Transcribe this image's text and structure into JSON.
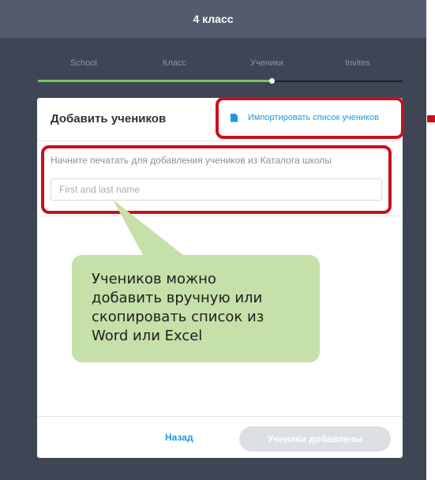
{
  "header": {
    "title": "4 класс"
  },
  "steps": [
    {
      "label": "School"
    },
    {
      "label": "Класс"
    },
    {
      "label": "Ученики"
    },
    {
      "label": "Invites"
    }
  ],
  "progress": {
    "completed_fraction": 0.64
  },
  "modal": {
    "title": "Добавить учеников",
    "import_label": "Импортировать список учеников",
    "import_icon": "document-icon",
    "hint": "Начните печатать для добавления учеников из Каталога школы",
    "name_input": {
      "value": "",
      "placeholder": "First and last name"
    },
    "back_label": "Назад",
    "done_label": "Ученики добавлены"
  },
  "callout": {
    "text": "Учеников можно\nдобавить вручную или\nскопировать список из\nWord или Excel"
  },
  "colors": {
    "app_background": "#3e4554",
    "header_background": "#555b6e",
    "accent_blue": "#1e9bd7",
    "progress_green": "#7cc45a",
    "highlight_red": "#c8101e",
    "callout_green": "#c5e0a9"
  }
}
